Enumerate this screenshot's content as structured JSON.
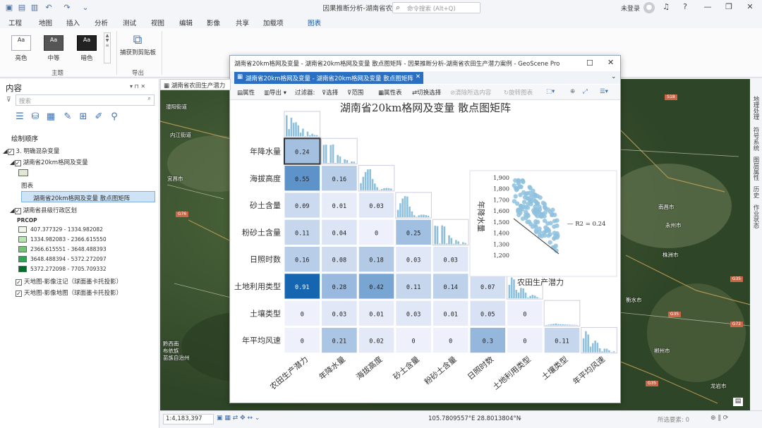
{
  "app": {
    "title": "因果推断分析-湖南省农田生产潜力案例",
    "search_placeholder": "命令搜索 (Alt+Q)",
    "user": "未登录",
    "help": "?"
  },
  "menu": [
    "工程",
    "地图",
    "插入",
    "分析",
    "测试",
    "视图",
    "编辑",
    "影像",
    "共享",
    "加载项",
    "图表"
  ],
  "ribbon": {
    "themes": [
      {
        "label": "亮色",
        "swatch": "Aa"
      },
      {
        "label": "中等",
        "swatch": "Aa"
      },
      {
        "label": "暗色",
        "swatch": "Aa"
      }
    ],
    "group_theme": "主题",
    "capture_label": "捕获到剪贴板",
    "group_export": "导出"
  },
  "contents": {
    "title": "内容",
    "search_placeholder": "搜索",
    "draw_order": "绘制顺序",
    "layers": [
      {
        "name": "3. 明确混杂变量",
        "checked": true
      },
      {
        "name": "湖南省20km格网及变量",
        "checked": true
      },
      {
        "name": "图表",
        "checked": false
      },
      {
        "name": "湖南省20km格网及变量 散点图矩阵",
        "checked": false
      },
      {
        "name": "湖南省县级行政区划",
        "checked": true
      },
      {
        "name": "PRCOP",
        "checked": false
      },
      {
        "name": "天地图-影像注记（球面墨卡托投影）",
        "checked": true
      },
      {
        "name": "天地图-影像地图（球面墨卡托投影）",
        "checked": true
      }
    ],
    "legend": [
      {
        "label": "407.377329 - 1334.982082",
        "color": "#edf8e9"
      },
      {
        "label": "1334.982083 - 2366.615550",
        "color": "#bae4b3"
      },
      {
        "label": "2366.615551 - 3648.488393",
        "color": "#74c476"
      },
      {
        "label": "3648.488394 - 5372.272097",
        "color": "#31a354"
      },
      {
        "label": "5372.272098 - 7705.709332",
        "color": "#006d2c"
      }
    ]
  },
  "map": {
    "tab_label": "湖南省农田生产潜力",
    "cities": [
      "澧阳街道",
      "内江街道",
      "宜昌市",
      "南昌市",
      "株洲市",
      "永州市",
      "衡水市",
      "郴州市",
      "龙岩市",
      "黔西南",
      "布依族",
      "苗族自治州"
    ],
    "shields": [
      "S18",
      "G76",
      "G35",
      "G35",
      "G35",
      "G72"
    ]
  },
  "right_tabs": [
    "地理处理",
    "符号系统",
    "图层属性",
    "历史",
    "作业状态"
  ],
  "status": {
    "scale": "1:4,183,397",
    "coords": "105.7809557°E 28.8013804°N",
    "selected": "所选要素: 0"
  },
  "popup": {
    "window_title": "湖南省20km格网及变量 - 湖南省20km格网及变量 散点图矩阵 - 因果推断分析-湖南省农田生产潜力案例 - GeoScene Pro",
    "tab_label": "湖南省20km格网及变量 - 湖南省20km格网及变量 散点图矩阵",
    "toolbar": {
      "properties": "属性",
      "export": "导出",
      "filter": "过滤器:",
      "select": "选择",
      "extent": "范围",
      "table": "属性表",
      "switch_selection": "切换选择",
      "clear_selection": "清除所选内容",
      "rotate": "旋转图表"
    }
  },
  "chart_data": {
    "type": "scatter_matrix",
    "title": "湖南省20km格网及变量 散点图矩阵",
    "variables": [
      "农田生产潜力",
      "年降水量",
      "海拔高度",
      "砂土含量",
      "粉砂土含量",
      "日照时数",
      "土地利用类型",
      "土壤类型",
      "年平均风速"
    ],
    "rows": [
      "年降水量",
      "海拔高度",
      "砂土含量",
      "粉砂土含量",
      "日照时数",
      "土地利用类型",
      "土壤类型",
      "年平均风速"
    ],
    "r2_matrix": [
      [
        "0.24"
      ],
      [
        "0.55",
        "0.16"
      ],
      [
        "0.09",
        "0.01",
        "0.03"
      ],
      [
        "0.11",
        "0.04",
        "0",
        "0.25"
      ],
      [
        "0.16",
        "0.08",
        "0.18",
        "0.03",
        "0.03"
      ],
      [
        "0.91",
        "0.28",
        "0.42",
        "0.11",
        "0.14",
        "0.07"
      ],
      [
        "0",
        "0.03",
        "0.01",
        "0.03",
        "0.01",
        "0.05",
        "0"
      ],
      [
        "0",
        "0.21",
        "0.02",
        "0",
        "0",
        "0.3",
        "0",
        "0.11"
      ]
    ],
    "preview": {
      "xlabel": "农田生产潜力",
      "ylabel": "年降水量",
      "r2_label": "R2 = 0.24",
      "y_ticks": [
        "1,900",
        "1,800",
        "1,700",
        "1,600",
        "1,500",
        "1,400",
        "1,300",
        "1,200"
      ]
    },
    "color_scale": {
      "low": "#eef0fb",
      "high": "#1565b0"
    }
  }
}
